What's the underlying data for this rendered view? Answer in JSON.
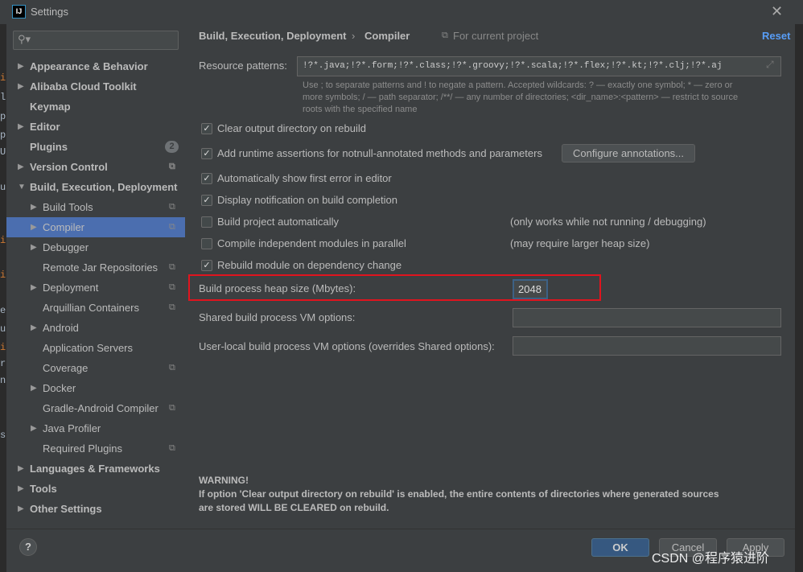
{
  "window": {
    "title": "Settings",
    "app_icon": "IJ"
  },
  "editor_gutter": [
    "i",
    "l",
    "p",
    "p",
    "U",
    "u",
    "i",
    "i",
    "e",
    "u",
    "i",
    "r",
    "n",
    "s"
  ],
  "sidebar": {
    "search_placeholder": "",
    "items": [
      {
        "label": "Appearance & Behavior",
        "bold": true,
        "arrow": "right"
      },
      {
        "label": "Alibaba Cloud Toolkit",
        "bold": true,
        "arrow": "right"
      },
      {
        "label": "Keymap",
        "bold": true
      },
      {
        "label": "Editor",
        "bold": true,
        "arrow": "right"
      },
      {
        "label": "Plugins",
        "bold": true,
        "badge": "2"
      },
      {
        "label": "Version Control",
        "bold": true,
        "arrow": "right",
        "project": true
      },
      {
        "label": "Build, Execution, Deployment",
        "bold": true,
        "arrow": "down"
      },
      {
        "label": "Build Tools",
        "child": true,
        "arrow": "right",
        "project": true
      },
      {
        "label": "Compiler",
        "child": true,
        "arrow": "right",
        "project": true,
        "selected": true
      },
      {
        "label": "Debugger",
        "child": true,
        "arrow": "right"
      },
      {
        "label": "Remote Jar Repositories",
        "child": true,
        "project": true
      },
      {
        "label": "Deployment",
        "child": true,
        "arrow": "right",
        "project": true
      },
      {
        "label": "Arquillian Containers",
        "child": true,
        "project": true
      },
      {
        "label": "Android",
        "child": true,
        "arrow": "right"
      },
      {
        "label": "Application Servers",
        "child": true
      },
      {
        "label": "Coverage",
        "child": true,
        "project": true
      },
      {
        "label": "Docker",
        "child": true,
        "arrow": "right"
      },
      {
        "label": "Gradle-Android Compiler",
        "child": true,
        "project": true
      },
      {
        "label": "Java Profiler",
        "child": true,
        "arrow": "right"
      },
      {
        "label": "Required Plugins",
        "child": true,
        "project": true
      },
      {
        "label": "Languages & Frameworks",
        "bold": true,
        "arrow": "right"
      },
      {
        "label": "Tools",
        "bold": true,
        "arrow": "right"
      },
      {
        "label": "Other Settings",
        "bold": true,
        "arrow": "right"
      }
    ]
  },
  "main": {
    "breadcrumb": [
      "Build, Execution, Deployment",
      "Compiler"
    ],
    "scope": "For current project",
    "reset": "Reset",
    "resource_label": "Resource patterns:",
    "resource_value": "!?*.java;!?*.form;!?*.class;!?*.groovy;!?*.scala;!?*.flex;!?*.kt;!?*.clj;!?*.aj",
    "hint_lines": [
      "Use ; to separate patterns and ! to negate a pattern. Accepted wildcards: ? — exactly one symbol; * — zero or",
      "more symbols; / — path separator; /**/ — any number of directories; <dir_name>:<pattern> — restrict to source",
      "roots with the specified name"
    ],
    "checkboxes": [
      {
        "label": "Clear output directory on rebuild",
        "checked": true
      },
      {
        "label": "Add runtime assertions for notnull-annotated methods and parameters",
        "checked": true
      },
      {
        "label": "Automatically show first error in editor",
        "checked": true
      },
      {
        "label": "Display notification on build completion",
        "checked": true
      },
      {
        "label": "Build project automatically",
        "checked": false,
        "note": "(only works while not running / debugging)"
      },
      {
        "label": "Compile independent modules in parallel",
        "checked": false,
        "note": "(may require larger heap size)"
      },
      {
        "label": "Rebuild module on dependency change",
        "checked": true
      }
    ],
    "configure_button": "Configure annotations...",
    "heap_label": "Build process heap size (Mbytes):",
    "heap_value": "2048",
    "shared_vm_label": "Shared build process VM options:",
    "shared_vm_value": "",
    "user_vm_label": "User-local build process VM options (overrides Shared options):",
    "user_vm_value": "",
    "warning_title": "WARNING!",
    "warning_lines": [
      "If option 'Clear output directory on rebuild' is enabled, the entire contents of directories where generated sources",
      "are stored WILL BE CLEARED on rebuild."
    ]
  },
  "footer": {
    "help": "?",
    "ok": "OK",
    "cancel": "Cancel",
    "apply": "Apply"
  },
  "watermark": "CSDN @程序猿进阶",
  "colors": {
    "accent": "#4b6eaf",
    "link": "#589df6",
    "highlight": "#e0141e",
    "ok": "#365880"
  }
}
